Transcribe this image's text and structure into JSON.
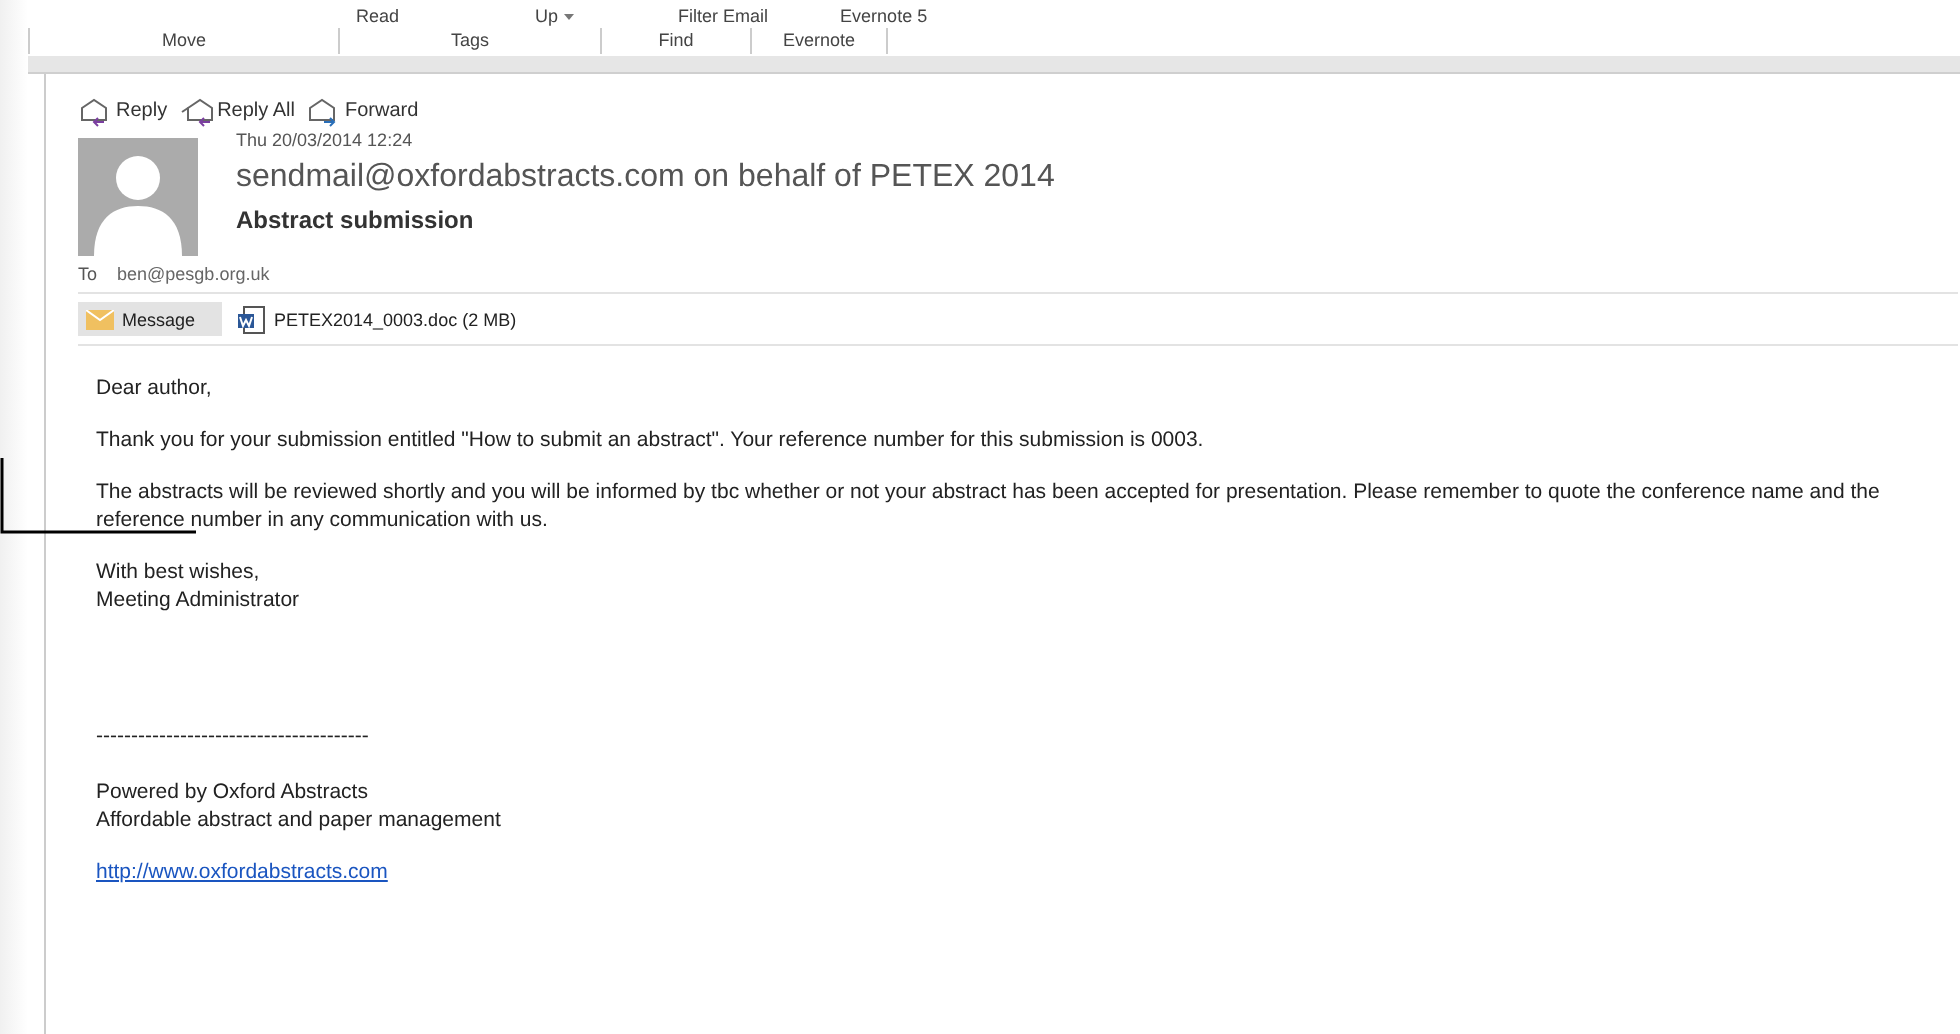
{
  "ribbon": {
    "top_items": [
      {
        "label": "Read",
        "caret": false
      },
      {
        "label": "Up",
        "caret": true
      },
      {
        "label": "Filter Email",
        "caret": false
      },
      {
        "label": "Evernote 5",
        "caret": false
      }
    ],
    "groups": [
      {
        "label": "Move"
      },
      {
        "label": "Tags"
      },
      {
        "label": "Find"
      },
      {
        "label": "Evernote"
      }
    ]
  },
  "actions": [
    {
      "label": "Reply",
      "kind": "reply"
    },
    {
      "label": "Reply All",
      "kind": "replyall"
    },
    {
      "label": "Forward",
      "kind": "forward"
    }
  ],
  "message": {
    "date": "Thu 20/03/2014 12:24",
    "sender": "sendmail@oxfordabstracts.com on behalf of PETEX 2014",
    "subject": "Abstract submission",
    "to_label": "To",
    "to": "ben@pesgb.org.uk"
  },
  "attachments": [
    {
      "label": "Message",
      "kind": "message",
      "selected": true
    },
    {
      "label": "PETEX2014_0003.doc (2 MB)",
      "kind": "doc",
      "selected": false
    }
  ],
  "body": [
    "Dear author,",
    "Thank you for your submission entitled \"How to submit an abstract\". Your reference number for this submission is 0003.",
    "The abstracts will be reviewed shortly and you will be informed by tbc whether or not your abstract has been accepted for presentation. Please remember to quote the conference name and the reference number in any communication with us.",
    "With best wishes,\nMeeting Administrator",
    "---------------------------------------",
    "Powered by Oxford Abstracts\nAffordable abstract and paper management"
  ],
  "link": "http://www.oxfordabstracts.com"
}
